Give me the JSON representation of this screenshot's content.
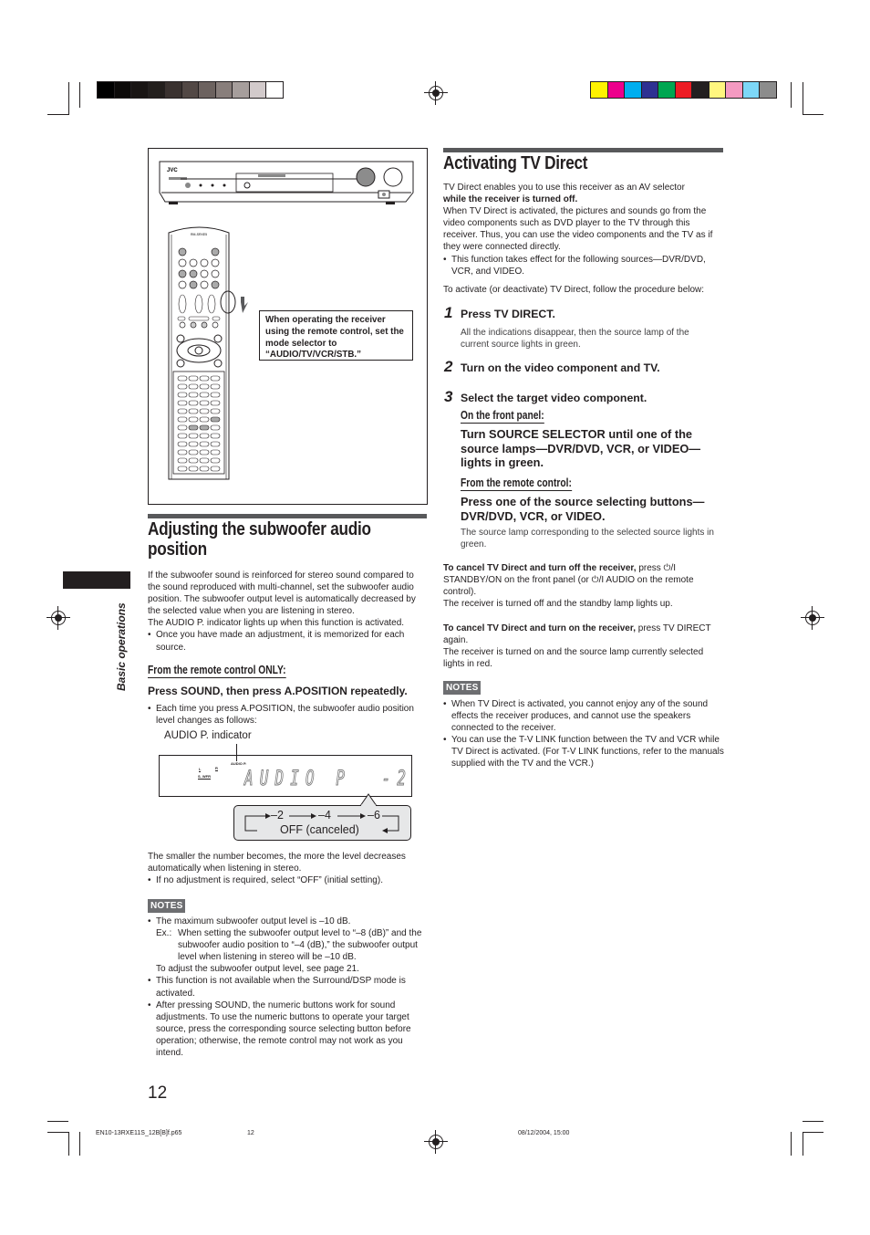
{
  "print_marks": {
    "grayscale_swatches": [
      "#000000",
      "#0c0a09",
      "#191514",
      "#231f1d",
      "#3a3230",
      "#524845",
      "#6c625f",
      "#887e7b",
      "#a69e9c",
      "#d2cacb",
      "#ffffff"
    ],
    "color_swatches": [
      "#fff200",
      "#ec008c",
      "#00aeef",
      "#2e3192",
      "#00a651",
      "#ed1c24",
      "#231f20",
      "#fff67f",
      "#f49ac1",
      "#7dd7f7",
      "#8c8c8c"
    ]
  },
  "side_tab": {
    "label": "Basic operations"
  },
  "figure_top": {
    "receiver_brand": "JVC",
    "remote_brand": "RM-SRXE5",
    "callout": "When operating the receiver using the remote control, set the mode selector to “AUDIO/TV/VCR/STB.”"
  },
  "left": {
    "title_line1": "Adjusting the subwoofer audio",
    "title_line2": "position",
    "intro": [
      "If the subwoofer sound is reinforced for stereo sound compared to the sound reproduced with multi-channel, set the subwoofer audio position. The subwoofer output level is automatically decreased by the selected value when you are listening in stereo.",
      "The AUDIO P. indicator lights up when this function is activated."
    ],
    "intro_bullet": "Once you have made an adjustment, it is memorized for each source.",
    "subhead": "From the remote control ONLY:",
    "instruction": "Press SOUND, then press A.POSITION repeatedly.",
    "instruction_bullet": "Each time you press A.POSITION, the subwoofer audio position level changes as follows:",
    "display": {
      "indicator_label": "AUDIO P. indicator",
      "lcd_small_l": "L",
      "lcd_small_r": "R",
      "lcd_small_swfr": "S. WFR",
      "lcd_small_audiop": "AUDIO P.",
      "lcd_text": "AUDIO P  -2",
      "cycle": [
        "–2",
        "–4",
        "–6"
      ],
      "cycle_return": "OFF (canceled)"
    },
    "after": "The smaller the number becomes, the more the level decreases automatically when listening in stereo.",
    "after_bullet": "If no adjustment is required, select “OFF” (initial setting).",
    "notes_label": "NOTES",
    "notes": {
      "n1": "The maximum subwoofer output level is –10 dB.",
      "n1_ex_label": "Ex.:",
      "n1_ex": "When setting the subwoofer output level to “–8 (dB)” and the subwoofer audio position to “–4 (dB),” the subwoofer output level when listening in stereo will be –10 dB.",
      "n1_more": "To adjust the subwoofer output level, see page 21.",
      "n2": "This function is not available when the Surround/DSP mode is activated.",
      "n3": "After pressing SOUND, the numeric buttons work for sound adjustments. To use the numeric buttons to operate your target source, press the corresponding source selecting button before operation; otherwise, the remote control may not work as you intend."
    }
  },
  "right": {
    "title": "Activating TV Direct",
    "intro1": "TV Direct enables you to use this receiver as an AV selector",
    "intro1_bold": "while the receiver is turned off.",
    "intro2": "When TV Direct is activated, the pictures and sounds go from the video components such as DVD player to the TV through this receiver. Thus, you can use the video components and the TV as if they were connected directly.",
    "intro_bullet": "This function takes effect for the following sources—DVR/DVD, VCR, and VIDEO.",
    "lead": "To activate (or deactivate) TV Direct, follow the procedure below:",
    "steps": [
      {
        "num": "1",
        "title": "Press TV DIRECT.",
        "desc": "All the indications disappear, then the source lamp of the current source lights in green."
      },
      {
        "num": "2",
        "title": "Turn on the video component and TV."
      },
      {
        "num": "3",
        "title": "Select the target video component."
      }
    ],
    "front_panel_label": "On the front panel:",
    "front_panel_action": "Turn SOURCE SELECTOR until one of the source lamps—DVR/DVD, VCR, or VIDEO—lights in green.",
    "remote_label": "From the remote control:",
    "remote_action": "Press one of the source selecting buttons—DVR/DVD, VCR, or VIDEO.",
    "remote_desc": "The source lamp corresponding to the selected source lights in green.",
    "cancel_off_bold": "To cancel TV Direct and turn off the receiver,",
    "cancel_off_rest": " press ⏻/I STANDBY/ON on the front panel (or ⏻/I AUDIO on the remote control).",
    "cancel_off_result": "The receiver is turned off and the standby lamp lights up.",
    "cancel_on_bold": "To cancel TV Direct and turn on the receiver,",
    "cancel_on_rest": " press TV DIRECT again.",
    "cancel_on_result": "The receiver is turned on and the source lamp currently selected lights in red.",
    "notes_label": "NOTES",
    "notes": [
      "When TV Direct is activated, you cannot enjoy any of the sound effects the receiver produces, and cannot use the speakers connected to the receiver.",
      "You can use the T-V LINK function between the TV and VCR while TV Direct is activated. (For T-V LINK functions, refer to the manuals supplied with the TV and the VCR.)"
    ]
  },
  "footer": {
    "page_number": "12",
    "file": "EN10-13RXE11S_12B[B]f.p65",
    "file_page": "12",
    "timestamp": "08/12/2004, 15:00"
  }
}
